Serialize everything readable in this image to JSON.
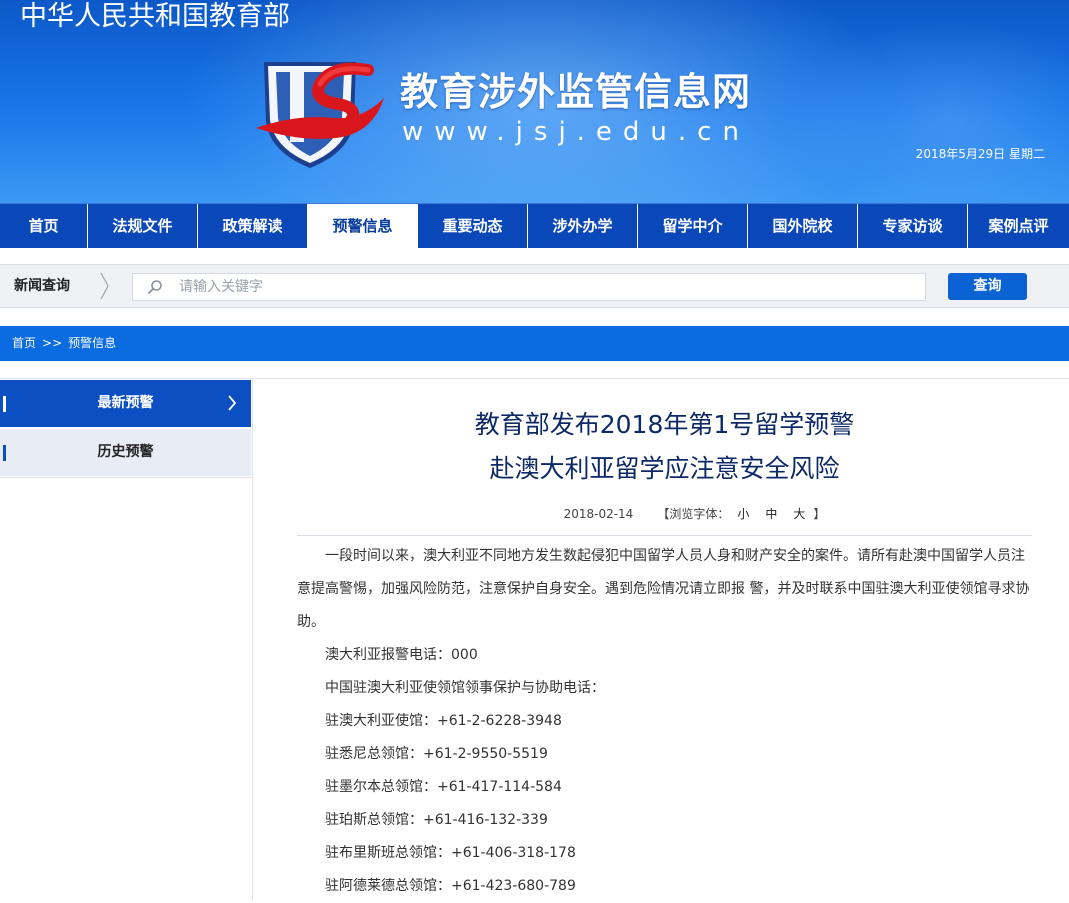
{
  "header": {
    "ministry": "中华人民共和国教育部",
    "site_title": "教育涉外监管信息网",
    "site_url": "www.jsj.edu.cn",
    "date": "2018年5月29日  星期二"
  },
  "nav": {
    "items": [
      {
        "label": "首页",
        "active": false
      },
      {
        "label": "法规文件",
        "active": false
      },
      {
        "label": "政策解读",
        "active": false
      },
      {
        "label": "预警信息",
        "active": true
      },
      {
        "label": "重要动态",
        "active": false
      },
      {
        "label": "涉外办学",
        "active": false
      },
      {
        "label": "留学中介",
        "active": false
      },
      {
        "label": "国外院校",
        "active": false
      },
      {
        "label": "专家访谈",
        "active": false
      },
      {
        "label": "案例点评",
        "active": false
      }
    ]
  },
  "search": {
    "label": "新闻查询",
    "placeholder": "请输入关键字",
    "button": "查询"
  },
  "breadcrumb": {
    "home": "首页",
    "separator": ">>",
    "current": "预警信息"
  },
  "sidebar": {
    "items": [
      {
        "label": "最新预警"
      },
      {
        "label": "历史预警"
      }
    ]
  },
  "article": {
    "title_line1": "教育部发布2018年第1号留学预警",
    "title_line2": "赴澳大利亚留学应注意安全风险",
    "date": "2018-02-14",
    "font_label": "【浏览字体：",
    "font_small": "小",
    "font_medium": "中",
    "font_large": "大",
    "font_end": "】",
    "paragraphs": [
      "一段时间以来，澳大利亚不同地方发生数起侵犯中国留学人员人身和财产安全的案件。请所有赴澳中国留学人员注意提高警惕，加强风险防范，注意保护自身安全。遇到危险情况请立即报 警，并及时联系中国驻澳大利亚使领馆寻求协助。",
      "澳大利亚报警电话：000",
      "中国驻澳大利亚使领馆领事保护与协助电话：",
      "驻澳大利亚使馆：+61-2-6228-3948",
      "驻悉尼总领馆：+61-2-9550-5519",
      "驻墨尔本总领馆：+61-417-114-584",
      "驻珀斯总领馆：+61-416-132-339",
      "驻布里斯班总领馆：+61-406-318-178",
      "驻阿德莱德总领馆：+61-423-680-789"
    ]
  },
  "colors": {
    "nav_bg": "#0a47b8",
    "crumb_bg": "#0b6be1",
    "button_bg": "#0b63d3",
    "title": "#0d2a66"
  }
}
